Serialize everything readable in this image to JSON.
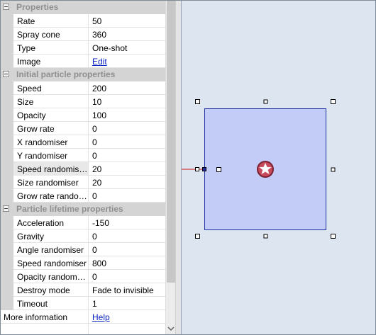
{
  "categories": {
    "properties": "Properties",
    "initial": "Initial particle properties",
    "lifetime": "Particle lifetime properties"
  },
  "rows": {
    "rate": {
      "name": "Rate",
      "value": "50"
    },
    "spray_cone": {
      "name": "Spray cone",
      "value": "360"
    },
    "type": {
      "name": "Type",
      "value": "One-shot"
    },
    "image": {
      "name": "Image",
      "value": "Edit"
    },
    "speed": {
      "name": "Speed",
      "value": "200"
    },
    "size": {
      "name": "Size",
      "value": "10"
    },
    "opacity": {
      "name": "Opacity",
      "value": "100"
    },
    "grow_rate": {
      "name": "Grow rate",
      "value": "0"
    },
    "x_randomiser": {
      "name": "X randomiser",
      "value": "0"
    },
    "y_randomiser": {
      "name": "Y randomiser",
      "value": "0"
    },
    "speed_randomiser_initial": {
      "name": "Speed randomis…",
      "value": "20"
    },
    "size_randomiser": {
      "name": "Size randomiser",
      "value": "20"
    },
    "grow_rate_randomiser": {
      "name": "Grow rate rando…",
      "value": "0"
    },
    "acceleration": {
      "name": "Acceleration",
      "value": "-150"
    },
    "gravity": {
      "name": "Gravity",
      "value": "0"
    },
    "angle_randomiser": {
      "name": "Angle randomiser",
      "value": "0"
    },
    "speed_randomiser_lifetime": {
      "name": "Speed randomiser",
      "value": "800"
    },
    "opacity_randomiser": {
      "name": "Opacity random…",
      "value": "0"
    },
    "destroy_mode": {
      "name": "Destroy mode",
      "value": "Fade to invisible"
    },
    "timeout": {
      "name": "Timeout",
      "value": "1"
    },
    "more_information": {
      "name": "More information",
      "value": "Help"
    }
  },
  "colors": {
    "canvas_bg": "#dde5f1",
    "object_fill": "#c3cbf7",
    "object_stroke": "#1f2e9e",
    "link": "#0b22c4",
    "category_bg": "#d4d4d4"
  },
  "icons": {
    "emitter": "star-badge-icon",
    "category_toggle": "minus-box-icon",
    "scroll_down": "chevron-down-icon"
  }
}
